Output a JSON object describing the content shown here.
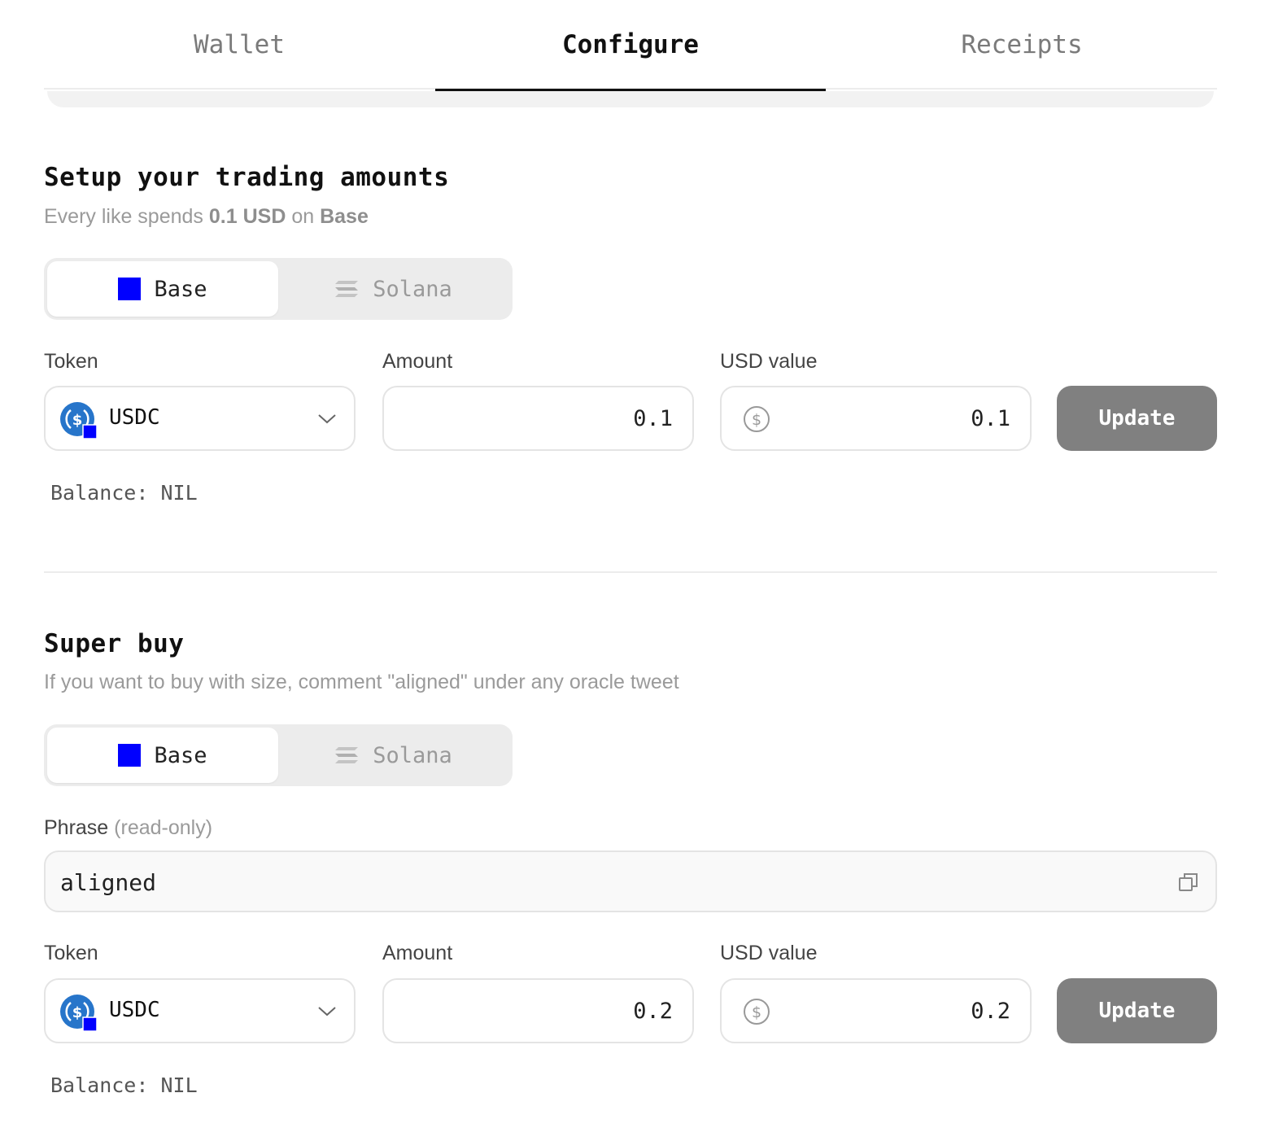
{
  "tabs": [
    {
      "label": "Wallet"
    },
    {
      "label": "Configure"
    },
    {
      "label": "Receipts"
    }
  ],
  "trading": {
    "title": "Setup your trading amounts",
    "subtitle_prefix": "Every like spends",
    "subtitle_amount": "0.1 USD",
    "subtitle_on": "on",
    "subtitle_chain": "Base",
    "chains": {
      "base": "Base",
      "solana": "Solana",
      "selected": "Base"
    },
    "token_label": "Token",
    "token": "USDC",
    "amount_label": "Amount",
    "amount": "0.1",
    "usd_label": "USD value",
    "usd_value": "0.1",
    "update_label": "Update",
    "balance": "Balance: NIL"
  },
  "superbuy": {
    "title": "Super buy",
    "subtitle": "If you want to buy with size, comment \"aligned\" under any oracle tweet",
    "chains": {
      "base": "Base",
      "solana": "Solana",
      "selected": "Base"
    },
    "phrase_label": "Phrase",
    "phrase_note": "(read-only)",
    "phrase": "aligned",
    "token_label": "Token",
    "token": "USDC",
    "amount_label": "Amount",
    "amount": "0.2",
    "usd_label": "USD value",
    "usd_value": "0.2",
    "update_label": "Update",
    "balance": "Balance: NIL"
  },
  "colors": {
    "base_brand": "#0000ff",
    "usdc_brand": "#2775ca",
    "button_bg": "#808080"
  },
  "icons": {
    "base": "base-square-icon",
    "solana": "solana-icon",
    "token": "usdc-icon",
    "dropdown": "chevron-down-icon",
    "usd": "dollar-circle-icon",
    "copy": "copy-icon"
  }
}
